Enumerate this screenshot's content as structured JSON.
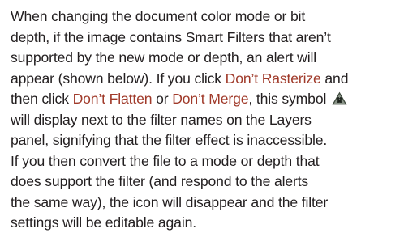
{
  "paragraph": {
    "line1": "When changing the document color mode or bit",
    "line2": "depth, if the image contains Smart Filters that aren’t",
    "line3": "supported by the new mode or depth, an alert will",
    "line4": "appear (shown below). If you click ",
    "link_dont_rasterize": "Don’t Rasterize",
    "line4_end": " and",
    "line5_start": "then click ",
    "link_dont_flatten": "Don’t Flatten",
    "line5_or": " or ",
    "link_dont_merge": "Don’t Merge",
    "line5_end": ", this symbol ",
    "line6": "will display next to the filter names on the Layers",
    "line7": "panel, signifying that the filter effect is inaccessible.",
    "line8": "If you then convert the file to a mode or depth that",
    "line9": "does support the filter (and respond to the alerts",
    "line10": "the same way), the icon will disappear and the filter",
    "line11": "settings will be editable again."
  },
  "icons": {
    "warning_symbol": "warning-triangle-icon"
  },
  "colors": {
    "body_text": "#231f20",
    "ui_label": "#a03a2a",
    "icon_fill": "#3f4a3e"
  }
}
